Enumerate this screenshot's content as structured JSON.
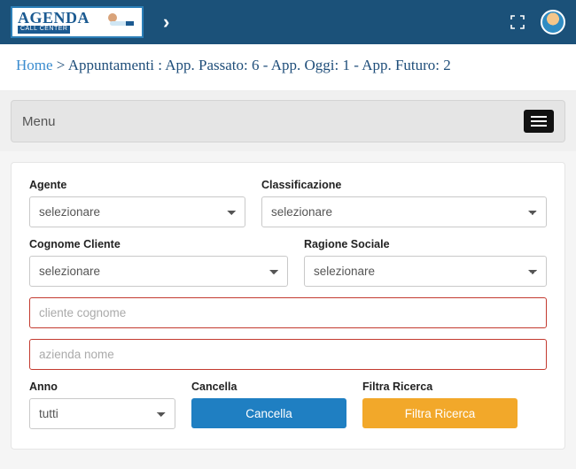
{
  "logo": {
    "main": "AGENDA",
    "sub": "CALL CENTER"
  },
  "breadcrumb": {
    "home": "Home",
    "sep": ">",
    "rest": "Appuntamenti : App. Passato: 6 - App. Oggi: 1 - App. Futuro: 2"
  },
  "menu": {
    "label": "Menu"
  },
  "form": {
    "agente": {
      "label": "Agente",
      "value": "selezionare"
    },
    "classificazione": {
      "label": "Classificazione",
      "value": "selezionare"
    },
    "cognome": {
      "label": "Cognome Cliente",
      "value": "selezionare"
    },
    "ragione": {
      "label": "Ragione Sociale",
      "value": "selezionare"
    },
    "cliente_cognome": {
      "placeholder": "cliente cognome"
    },
    "azienda_nome": {
      "placeholder": "azienda nome"
    },
    "anno": {
      "label": "Anno",
      "value": "tutti"
    },
    "cancella": {
      "label": "Cancella",
      "button": "Cancella"
    },
    "filtra": {
      "label": "Filtra Ricerca",
      "button": "Filtra Ricerca"
    }
  }
}
